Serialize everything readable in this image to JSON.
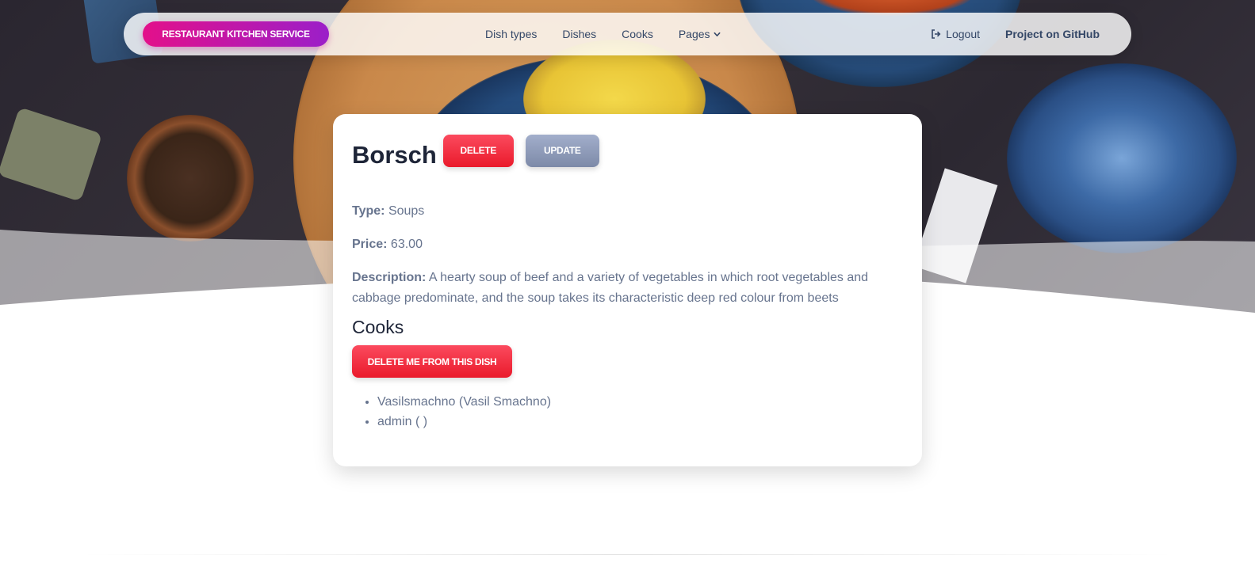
{
  "navbar": {
    "brand": "RESTAURANT KITCHEN SERVICE",
    "links": [
      {
        "label": "Dish types"
      },
      {
        "label": "Dishes"
      },
      {
        "label": "Cooks"
      },
      {
        "label": "Pages"
      }
    ],
    "logout_label": "Logout",
    "github_label": "Project on GitHub"
  },
  "dish": {
    "name": "Borsch",
    "delete_label": "DELETE",
    "update_label": "UPDATE",
    "type_label": "Type:",
    "type_value": "Soups",
    "price_label": "Price:",
    "price_value": "63.00",
    "description_label": "Description:",
    "description_value": "A hearty soup of beef and a variety of vegetables in which root vegetables and cabbage predominate, and the soup takes its characteristic deep red colour from beets"
  },
  "cooks": {
    "heading": "Cooks",
    "remove_label": "DELETE ME FROM THIS DISH",
    "items": [
      {
        "label": "Vasilsmachno (Vasil Smachno)"
      },
      {
        "label": "admin ( )"
      }
    ]
  },
  "icons": {
    "logout": "sign-out-icon",
    "pages_dropdown": "chevron-down-icon"
  },
  "colors": {
    "brand_gradient_start": "#e3108a",
    "brand_gradient_end": "#9b1fc9",
    "danger": "#ea1a2b",
    "secondary": "#7d8aa8",
    "heading": "#1e2538",
    "text": "#67748e"
  }
}
